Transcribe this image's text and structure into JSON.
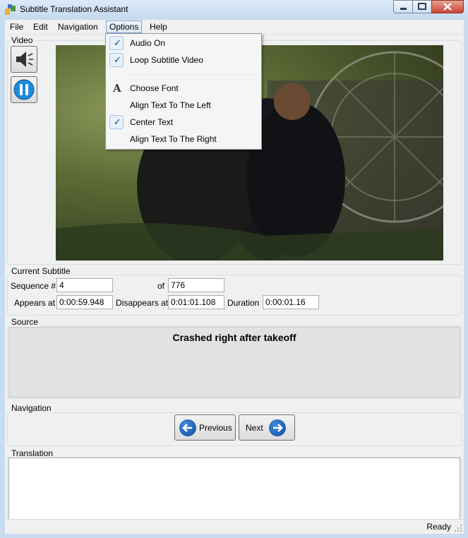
{
  "window": {
    "title": "Subtitle Translation Assistant"
  },
  "menubar": [
    "File",
    "Edit",
    "Navigation",
    "Options",
    "Help"
  ],
  "options_menu": {
    "items": [
      {
        "label": "Audio On",
        "checked": true
      },
      {
        "label": "Loop Subtitle Video",
        "checked": true
      },
      {
        "label": "Choose Font",
        "icon": "font-icon"
      },
      {
        "label": "Align Text To The Left",
        "checked": false
      },
      {
        "label": "Center Text",
        "checked": true
      },
      {
        "label": "Align Text To The Right",
        "checked": false
      }
    ],
    "font_glyph": "A",
    "check_glyph": "✓"
  },
  "video": {
    "label": "Video",
    "buttons": [
      "speaker-icon",
      "pause-icon"
    ]
  },
  "current_subtitle": {
    "label": "Current Subtitle",
    "sequence_label": "Sequence #",
    "sequence_value": "4",
    "of_label": "of",
    "of_value": "776",
    "appears_label": "Appears at",
    "appears_value": "0:00:59.948",
    "disappears_label": "Disappears at",
    "disappears_value": "0:01:01.108",
    "duration_label": "Duration",
    "duration_value": "0:00:01.16"
  },
  "source": {
    "label": "Source",
    "text": "Crashed right after takeoff"
  },
  "navigation": {
    "label": "Navigation",
    "previous": "Previous",
    "next": "Next"
  },
  "translation": {
    "label": "Translation",
    "value": ""
  },
  "status": {
    "text": "Ready"
  },
  "colors": {
    "accent": "#1560bd",
    "menu_highlight": "#d9e6f5"
  }
}
